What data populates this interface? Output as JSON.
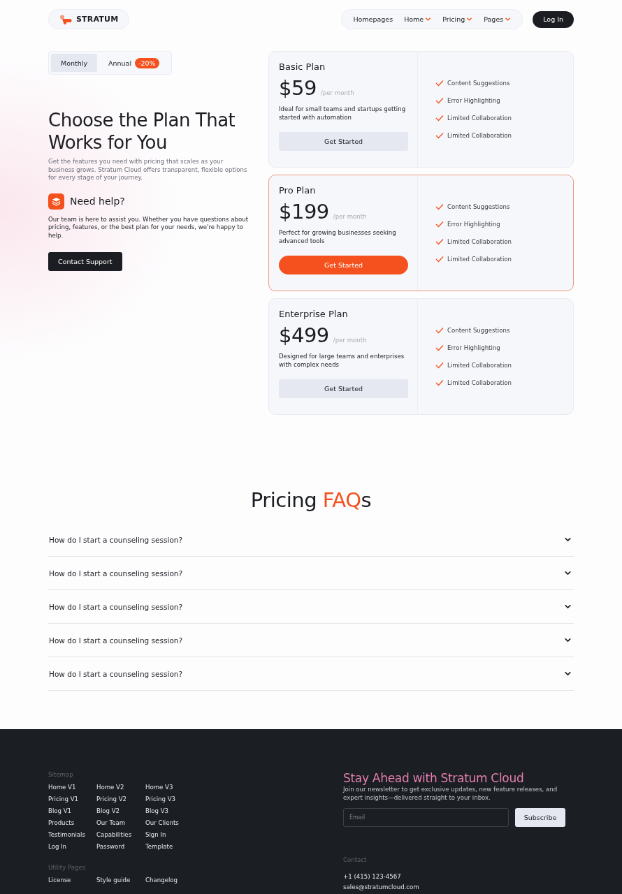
{
  "nav": {
    "brand": "STRATUM",
    "links": [
      {
        "label": "Homepages",
        "dropdown": false
      },
      {
        "label": "Home",
        "dropdown": true
      },
      {
        "label": "Pricing",
        "dropdown": true
      },
      {
        "label": "Pages",
        "dropdown": true
      }
    ],
    "login": "Log In"
  },
  "billing": {
    "options": [
      {
        "label": "Monthly",
        "selected": true
      },
      {
        "label": "Annual",
        "selected": false,
        "badge": "-20%"
      }
    ]
  },
  "hero": {
    "title": "Choose the Plan That Works for You",
    "subtitle": "Get the features you need with pricing that scales as your business grows. Stratum Cloud offers transparent, flexible options for every stage of your journey.",
    "help_title": "Need help?",
    "help_text": "Our team is here to assist you. Whether you have questions about pricing, features, or the best plan for your needs, we're happy to help.",
    "contact_button": "Contact Support"
  },
  "plans": [
    {
      "name": "Basic Plan",
      "price": "$59",
      "period": "/per month",
      "description": "Ideal for small teams and startups getting started with automation",
      "button": "Get Started",
      "featured": false,
      "features": [
        "Content Suggestions",
        "Error Highlighting",
        "Limited Collaboration",
        "Limited Collaboration"
      ]
    },
    {
      "name": "Pro Plan",
      "price": "$199",
      "period": "/per month",
      "description": "Perfect for growing businesses seeking advanced tools",
      "button": "Get Started",
      "featured": true,
      "features": [
        "Content Suggestions",
        "Error Highlighting",
        "Limited Collaboration",
        "Limited Collaboration"
      ]
    },
    {
      "name": "Enterprise Plan",
      "price": "$499",
      "period": "/per month",
      "description": "Designed for large teams and enterprises with complex needs",
      "button": "Get Started",
      "featured": false,
      "features": [
        "Content Suggestions",
        "Error Highlighting",
        "Limited Collaboration",
        "Limited Collaboration"
      ]
    }
  ],
  "faq": {
    "title_parts": [
      {
        "text": "Pricing ",
        "accent": false
      },
      {
        "text": "FAQ",
        "accent": true
      },
      {
        "text": "s",
        "accent": false
      }
    ],
    "items": [
      {
        "question": "How do I start a counseling session?",
        "expanded": false
      },
      {
        "question": "How do I start a counseling session?",
        "expanded": false
      },
      {
        "question": "How do I start a counseling session?",
        "expanded": false
      },
      {
        "question": "How do I start a counseling session?",
        "expanded": false
      },
      {
        "question": "How do I start a counseling session?",
        "expanded": false
      }
    ]
  },
  "footer": {
    "sitemap_label": "Sitemap",
    "sitemap": [
      "Home V1",
      "Home V2",
      "Home V3",
      "Pricing V1",
      "Pricing V2",
      "Pricing V3",
      "Blog V1",
      "Blog V2",
      "Blog V3",
      "Products",
      "Our Team",
      "Our Clients",
      "Testimonials",
      "Capabilities",
      "Sign In",
      "Log In",
      "Password",
      "Template"
    ],
    "utility_label": "Utility Pages",
    "utility": [
      "License",
      "Style guide",
      "Changelog"
    ],
    "newsletter_title": "Stay Ahead with Stratum Cloud",
    "newsletter_text": "Join our newsletter to get exclusive updates, new feature releases, and expert insights—delivered straight to your inbox.",
    "email_placeholder": "Email",
    "subscribe": "Subscribe",
    "contact_label": "Contact",
    "phone": "+1 (415) 123-4567",
    "email": "sales@stratumcloud.com"
  }
}
